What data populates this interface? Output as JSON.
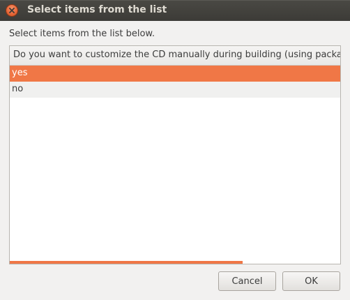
{
  "window": {
    "title": "Select items from the list",
    "close_icon": "close-icon"
  },
  "prompt": "Select items from the list below.",
  "list": {
    "column_header": "Do you want to customize the CD manually during building (using packages",
    "items": [
      {
        "label": "yes",
        "selected": true
      },
      {
        "label": "no",
        "selected": false
      }
    ]
  },
  "buttons": {
    "cancel_label": "Cancel",
    "ok_label": "OK"
  },
  "colors": {
    "accent": "#f07746",
    "titlebar": "#3c3b37",
    "background": "#f2f1f0"
  }
}
